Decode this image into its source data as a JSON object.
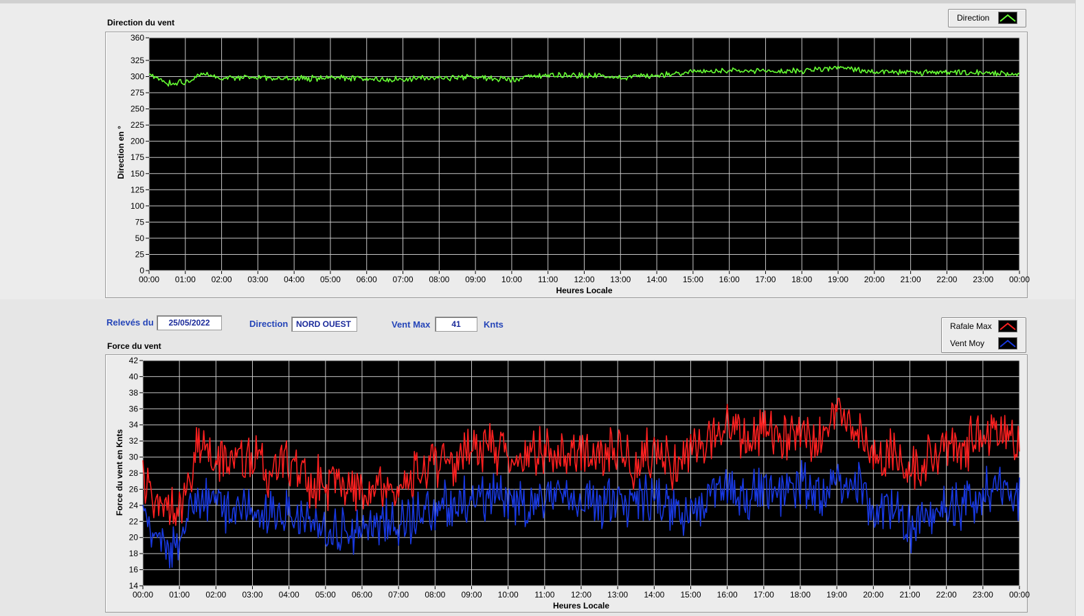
{
  "charts": {
    "direction": {
      "title": "Direction du vent",
      "ylabel": "Direction en °",
      "xlabel": "Heures Locale",
      "legend": [
        {
          "label": "Direction",
          "color": "#66ff33"
        }
      ]
    },
    "force": {
      "title": "Force du vent",
      "ylabel": "Force du vent en Knts",
      "xlabel": "Heures Locale",
      "legend": [
        {
          "label": "Rafale Max",
          "color": "#ff2020"
        },
        {
          "label": "Vent Moy",
          "color": "#1838e0"
        }
      ]
    }
  },
  "fields": {
    "releves_label": "Relevés du",
    "releves_value": "25/05/2022",
    "direction_label": "Direction",
    "direction_value": "NORD OUEST",
    "ventmax_label": "Vent Max",
    "ventmax_value": "41",
    "ventmax_unit": "Knts"
  },
  "chart_data": [
    {
      "type": "line",
      "title": "Direction du vent",
      "xlabel": "Heures Locale",
      "ylabel": "Direction en °",
      "x_ticks": [
        "00:00",
        "01:00",
        "02:00",
        "03:00",
        "04:00",
        "05:00",
        "06:00",
        "07:00",
        "08:00",
        "09:00",
        "10:00",
        "11:00",
        "12:00",
        "13:00",
        "14:00",
        "15:00",
        "16:00",
        "17:00",
        "18:00",
        "19:00",
        "20:00",
        "21:00",
        "22:00",
        "23:00",
        "00:00"
      ],
      "y_ticks": [
        0,
        25,
        50,
        75,
        100,
        125,
        150,
        175,
        200,
        225,
        250,
        275,
        300,
        325,
        360
      ],
      "ylim": [
        0,
        360
      ],
      "grid": true,
      "legend_position": "top-right",
      "series": [
        {
          "name": "Direction",
          "color": "#66ff33",
          "x": [
            "00:00",
            "00:30",
            "01:00",
            "01:30",
            "02:00",
            "03:00",
            "04:00",
            "05:00",
            "06:00",
            "07:00",
            "08:00",
            "09:00",
            "10:00",
            "11:00",
            "12:00",
            "13:00",
            "14:00",
            "15:00",
            "16:00",
            "17:00",
            "18:00",
            "19:00",
            "20:00",
            "21:00",
            "22:00",
            "23:00",
            "00:00"
          ],
          "values": [
            303,
            290,
            292,
            303,
            298,
            299,
            296,
            298,
            296,
            296,
            298,
            299,
            296,
            303,
            302,
            299,
            302,
            308,
            308,
            308,
            309,
            314,
            307,
            306,
            306,
            305,
            305
          ]
        }
      ]
    },
    {
      "type": "line",
      "title": "Force du vent",
      "xlabel": "Heures Locale",
      "ylabel": "Force du vent en Knts",
      "x_ticks": [
        "00:00",
        "01:00",
        "02:00",
        "03:00",
        "04:00",
        "05:00",
        "06:00",
        "07:00",
        "08:00",
        "09:00",
        "10:00",
        "11:00",
        "12:00",
        "13:00",
        "14:00",
        "15:00",
        "16:00",
        "17:00",
        "18:00",
        "19:00",
        "20:00",
        "21:00",
        "22:00",
        "23:00",
        "00:00"
      ],
      "y_ticks": [
        14,
        16,
        18,
        20,
        22,
        24,
        26,
        28,
        30,
        32,
        34,
        36,
        38,
        40,
        42
      ],
      "ylim": [
        14,
        42
      ],
      "grid": true,
      "legend_position": "top-right",
      "series": [
        {
          "name": "Rafale Max",
          "color": "#ff2020",
          "x": [
            "00:00",
            "00:30",
            "01:00",
            "01:30",
            "02:00",
            "02:30",
            "03:00",
            "03:30",
            "04:00",
            "04:30",
            "05:00",
            "05:30",
            "06:00",
            "06:30",
            "07:00",
            "07:30",
            "08:00",
            "08:30",
            "09:00",
            "09:30",
            "10:00",
            "10:30",
            "11:00",
            "11:30",
            "12:00",
            "12:30",
            "13:00",
            "13:30",
            "14:00",
            "14:30",
            "15:00",
            "15:30",
            "16:00",
            "16:30",
            "17:00",
            "17:30",
            "18:00",
            "18:30",
            "19:00",
            "19:30",
            "20:00",
            "20:30",
            "21:00",
            "21:30",
            "22:00",
            "22:30",
            "23:00",
            "23:30",
            "00:00"
          ],
          "values": [
            27,
            24,
            23,
            32,
            29,
            30,
            30,
            28,
            29,
            27,
            27,
            26,
            25,
            26,
            25,
            28,
            29,
            29,
            31,
            31,
            30,
            30,
            31,
            30,
            31,
            30,
            31,
            29,
            31,
            29,
            30,
            32,
            34,
            32,
            33,
            32,
            34,
            32,
            36,
            34,
            30,
            31,
            28,
            30,
            31,
            31,
            33,
            34,
            31
          ]
        },
        {
          "name": "Vent Moy",
          "color": "#1838e0",
          "x": [
            "00:00",
            "00:30",
            "01:00",
            "01:30",
            "02:00",
            "02:30",
            "03:00",
            "03:30",
            "04:00",
            "04:30",
            "05:00",
            "05:30",
            "06:00",
            "06:30",
            "07:00",
            "07:30",
            "08:00",
            "08:30",
            "09:00",
            "09:30",
            "10:00",
            "10:30",
            "11:00",
            "11:30",
            "12:00",
            "12:30",
            "13:00",
            "13:30",
            "14:00",
            "14:30",
            "15:00",
            "15:30",
            "16:00",
            "16:30",
            "17:00",
            "17:30",
            "18:00",
            "18:30",
            "19:00",
            "19:30",
            "20:00",
            "20:30",
            "21:00",
            "21:30",
            "22:00",
            "22:30",
            "23:00",
            "23:30",
            "00:00"
          ],
          "values": [
            22,
            19,
            19,
            25,
            24,
            23,
            23,
            23,
            23,
            22,
            21,
            21,
            21,
            22,
            21,
            23,
            24,
            24,
            25,
            25,
            25,
            24,
            25,
            24,
            25,
            24,
            25,
            24,
            25,
            23,
            23,
            25,
            26,
            25,
            26,
            25,
            27,
            25,
            28,
            27,
            23,
            24,
            21,
            23,
            24,
            24,
            26,
            27,
            25
          ]
        }
      ]
    }
  ]
}
